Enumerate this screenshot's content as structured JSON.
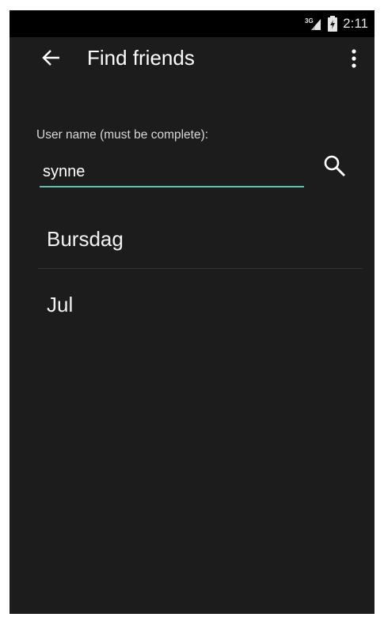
{
  "status_bar": {
    "network_label": "3G",
    "time": "2:11"
  },
  "action_bar": {
    "title": "Find friends",
    "back_icon": "arrow-back-icon",
    "overflow_icon": "more-vert-icon"
  },
  "search": {
    "label": "User name (must be complete):",
    "value": "synne",
    "icon": "search-icon"
  },
  "results": [
    {
      "label": "Bursdag"
    },
    {
      "label": "Jul"
    }
  ],
  "colors": {
    "background": "#1c1c1c",
    "status_bar": "#000000",
    "accent": "#5fbfb5",
    "text": "#ffffff"
  }
}
